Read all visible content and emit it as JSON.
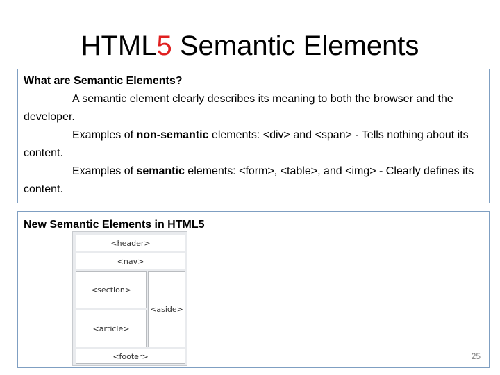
{
  "title": {
    "prefix": "HTML",
    "accent": "5",
    "suffix": " Semantic Elements"
  },
  "section1": {
    "heading": "What are Semantic Elements?",
    "p1": "A semantic element clearly describes its meaning to both the browser and the developer.",
    "p2_start": "Examples of ",
    "p2_bold": "non-semantic",
    "p2_end": " elements: <div> and <span> - Tells nothing about its content.",
    "p3_start": "Examples of ",
    "p3_bold": "semantic",
    "p3_end": " elements: <form>, <table>, and <img> - Clearly defines its content."
  },
  "section2": {
    "heading": "New Semantic Elements in HTML5",
    "diagram": {
      "header": "<header>",
      "nav": "<nav>",
      "section": "<section>",
      "article": "<article>",
      "aside": "<aside>",
      "footer": "<footer>"
    }
  },
  "page_number": "25",
  "colors": {
    "accent": "#e02020",
    "box_border": "#7f9fc2"
  }
}
